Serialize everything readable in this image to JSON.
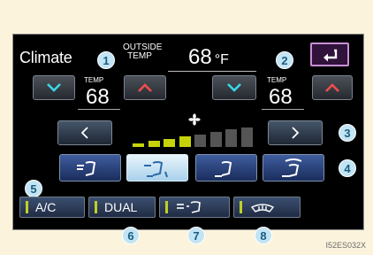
{
  "header": {
    "title": "Climate",
    "outside_temp_label": "OUTSIDE TEMP",
    "outside_temp_value": "68",
    "outside_temp_unit": "°F"
  },
  "left_zone": {
    "temp_label": "TEMP",
    "temp_value": "68"
  },
  "right_zone": {
    "temp_label": "TEMP",
    "temp_value": "68"
  },
  "fan": {
    "level": 4,
    "max_level": 8,
    "active_color": "#c5d40a",
    "inactive_color": "#555555"
  },
  "modes": [
    {
      "icon": "face-vent-icon",
      "selected": false
    },
    {
      "icon": "face-floor-vent-icon",
      "selected": true
    },
    {
      "icon": "floor-vent-icon",
      "selected": false
    },
    {
      "icon": "floor-defrost-vent-icon",
      "selected": false
    }
  ],
  "bottom": {
    "ac_label": "A/C",
    "dual_label": "DUAL",
    "recirc_icon": "recirculation-icon",
    "defrost_icon": "windshield-defrost-icon"
  },
  "callouts": [
    "1",
    "2",
    "3",
    "4",
    "5",
    "6",
    "7",
    "8"
  ],
  "figure_code": "I52ES032X",
  "colors": {
    "accent": "#c98fd6",
    "indicator": "#c1cf26",
    "callout": "#c2e4f4"
  }
}
